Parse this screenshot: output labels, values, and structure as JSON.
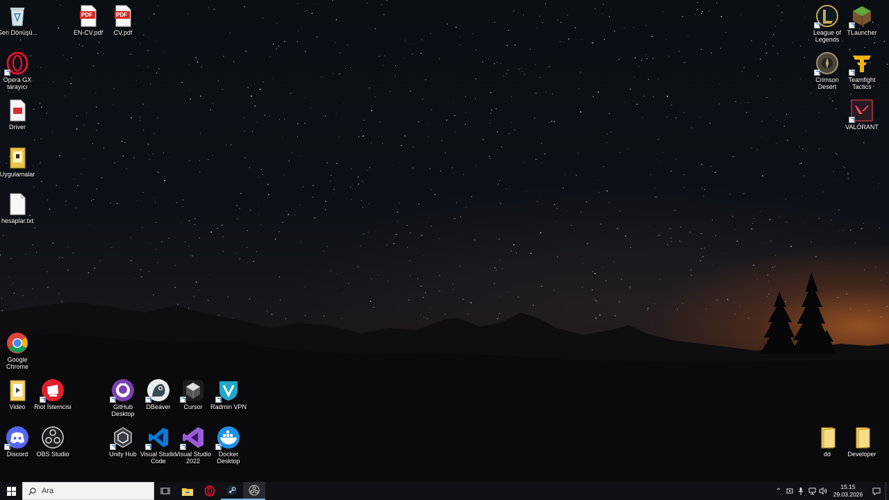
{
  "desktop": {
    "icons_left": {
      "recycle_bin": "Geri Dönüşü...",
      "opera_gx": "Opera GX tarayıcı",
      "driver": "Driver",
      "uygulamalar": "Uygulamalar",
      "hesaplar": "hesaplar.txt",
      "en_cv": "EN-CV.pdf",
      "cv": "CV.pdf",
      "chrome": "Google Chrome",
      "video": "Video",
      "riot": "Riot İstemcisi",
      "discord": "Discord",
      "obs": "OBS Studio",
      "github": "GitHub Desktop",
      "dbeaver": "DBeaver",
      "cursor": "Cursor",
      "radmin": "Radmin VPN",
      "unity": "Unity Hub",
      "vscode": "Visual Studio Code",
      "vs2022": "Visual Studio 2022",
      "docker": "Docker Desktop"
    },
    "icons_right": {
      "lol": "League of Legends",
      "tlauncher": "TLauncher",
      "crimson": "Crimson Desert",
      "tft": "Teamfight Tactics",
      "valorant": "VALORANT",
      "dd": "dd",
      "developer": "Developer"
    },
    "pdf_badge": "PDF"
  },
  "taskbar": {
    "search_placeholder": "Ara",
    "time": "15:15",
    "date": "29.03.2026"
  }
}
